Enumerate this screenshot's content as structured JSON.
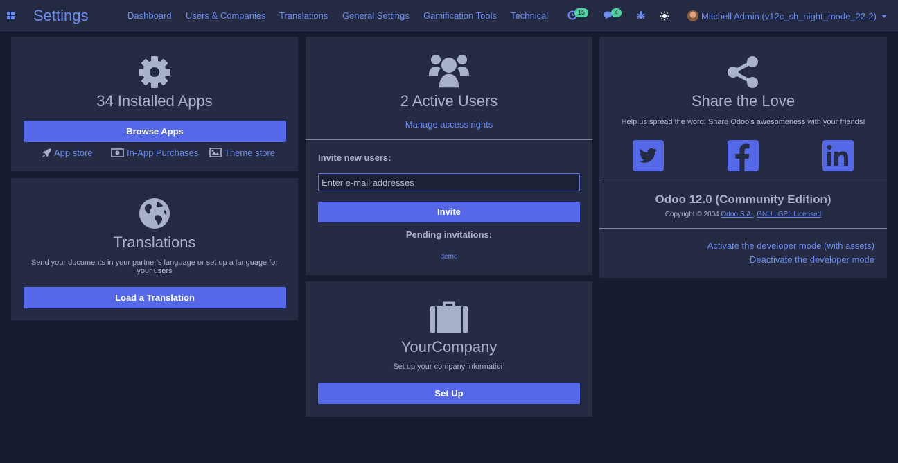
{
  "navbar": {
    "brand": "Settings",
    "menu": [
      "Dashboard",
      "Users & Companies",
      "Translations",
      "General Settings",
      "Gamification Tools",
      "Technical"
    ],
    "activity_count": "15",
    "messages_count": "4",
    "user": "Mitchell Admin (v12c_sh_night_mode_22-2)"
  },
  "apps": {
    "title": "34 Installed Apps",
    "browse_label": "Browse Apps",
    "links": [
      "App store",
      "In-App Purchases",
      "Theme store"
    ]
  },
  "translations": {
    "title": "Translations",
    "description": "Send your documents in your partner's language or set up a language for your users",
    "load_label": "Load a Translation"
  },
  "users": {
    "title": "2 Active Users",
    "manage_label": "Manage access rights",
    "invite_heading": "Invite new users:",
    "email_placeholder": "Enter e-mail addresses",
    "invite_label": "Invite",
    "pending_heading": "Pending invitations:",
    "pending": [
      "demo"
    ]
  },
  "company": {
    "title": "YourCompany",
    "description": "Set up your company information",
    "setup_label": "Set Up"
  },
  "share": {
    "title": "Share the Love",
    "description": "Help us spread the word: Share Odoo's awesomeness with your friends!",
    "version": "Odoo 12.0 (Community Edition)",
    "copyright_prefix": "Copyright © 2004 ",
    "company_link": "Odoo S.A.",
    "license_link": "GNU LGPL Licensed",
    "dev_mode_assets": "Activate the developer mode (with assets)",
    "dev_mode_deactivate": "Deactivate the developer mode"
  },
  "colors": {
    "accent": "#6a8bf0",
    "button": "#5468e8",
    "card": "#252b43",
    "background": "#171c30",
    "badge": "#4fd3a0"
  }
}
